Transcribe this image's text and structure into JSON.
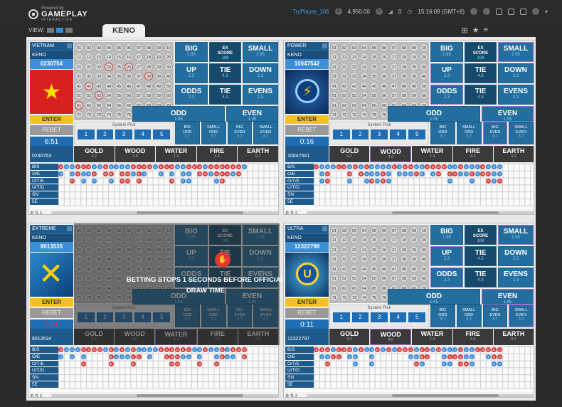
{
  "header": {
    "powered": "Powered by",
    "brand": "GAMEPLAY",
    "brand_sub": "INTERACTIVE",
    "user": "TryPlayer_105",
    "balance": "4,950.00",
    "bell_count": "0",
    "time": "15:16:09 (GMT+8)",
    "view_label": "VIEW:",
    "tab": "KENO"
  },
  "labels": {
    "enter": "ENTER",
    "rebet": "REBET",
    "system_pick": "System Pick",
    "picks": [
      "1",
      "2",
      "3",
      "4",
      "5"
    ],
    "bets": {
      "big": "BIG",
      "small": "SMALL",
      "ex": "EX SCORE",
      "up": "UP",
      "tie": "TIE",
      "down": "DOWN",
      "odds": "ODDS",
      "evens": "EVENS",
      "odd": "ODD",
      "even": "EVEN"
    },
    "odds": {
      "big": "1.95",
      "small": "1.95",
      "ex": "108",
      "up": "2.3",
      "tie": "4.3",
      "down": "2.3",
      "odds": "2.3",
      "evens": "2.3",
      "odd": "1.95",
      "even": "1.95"
    },
    "comb": [
      {
        "a": "BIG",
        "b": "ODD",
        "o": "3.7"
      },
      {
        "a": "SMALL",
        "b": "ODD",
        "o": "3.7"
      },
      {
        "a": "BIG",
        "b": "EVEN",
        "o": "3.7"
      },
      {
        "a": "SMALL",
        "b": "EVEN",
        "o": "3.7"
      }
    ],
    "elements": [
      {
        "n": "GOLD",
        "o": "9.2"
      },
      {
        "n": "WOOD",
        "o": "4.6"
      },
      {
        "n": "WATER",
        "o": "2.4"
      },
      {
        "n": "FIRE",
        "o": "4.6"
      },
      {
        "n": "EARTH",
        "o": "9.2"
      }
    ],
    "roads": [
      "B/S",
      "O/E",
      "O/T/E",
      "U/T/D",
      "SN",
      "5E"
    ],
    "overlay": "BETTING STOPS 1 SECONDS BEFORE OFFICIAL DRAW TIME"
  },
  "panels": [
    {
      "name": "VIETNAM",
      "game": "KENO",
      "draw": "0230754",
      "timer": "6:51",
      "prev": "0230753"
    },
    {
      "name": "POWER",
      "game": "KENO",
      "draw": "10047542",
      "timer": "0:16",
      "prev": "10047541"
    },
    {
      "name": "EXTREME",
      "game": "KENO",
      "draw": "8013535",
      "timer": "0:01",
      "prev": "8013534"
    },
    {
      "name": "ULTRA",
      "game": "KENO",
      "draw": "12322798",
      "timer": "0:11",
      "prev": "12322797"
    }
  ],
  "colors": {
    "accent": "#1f6db2",
    "enter": "#f3c21f",
    "big": "#d63a3a",
    "small": "#3a8ad6"
  }
}
